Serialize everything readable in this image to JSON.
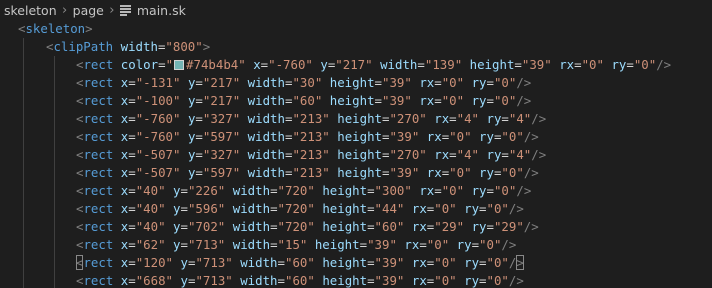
{
  "breadcrumb": {
    "items": [
      "skeleton",
      "page",
      "main.sk"
    ],
    "file_icon": "file-text-icon"
  },
  "editor": {
    "lines": [
      [
        [
          "p",
          "<"
        ],
        [
          "t",
          "skeleton"
        ],
        [
          "p",
          ">"
        ]
      ],
      [
        [
          "p",
          "<"
        ],
        [
          "t",
          "clipPath"
        ],
        [
          "x",
          " "
        ],
        [
          "a",
          "width"
        ],
        [
          "x",
          "="
        ],
        [
          "s",
          "\"800\""
        ],
        [
          "p",
          ">"
        ]
      ],
      [
        [
          "p",
          "<"
        ],
        [
          "t",
          "rect"
        ],
        [
          "x",
          " "
        ],
        [
          "a",
          "color"
        ],
        [
          "x",
          "="
        ],
        [
          "s",
          "\""
        ],
        [
          "sw",
          "#74b4b4"
        ],
        [
          "s",
          "#74b4b4\""
        ],
        [
          "x",
          " "
        ],
        [
          "a",
          "x"
        ],
        [
          "x",
          "="
        ],
        [
          "s",
          "\"-760\""
        ],
        [
          "x",
          " "
        ],
        [
          "a",
          "y"
        ],
        [
          "x",
          "="
        ],
        [
          "s",
          "\"217\""
        ],
        [
          "x",
          " "
        ],
        [
          "a",
          "width"
        ],
        [
          "x",
          "="
        ],
        [
          "s",
          "\"139\""
        ],
        [
          "x",
          " "
        ],
        [
          "a",
          "height"
        ],
        [
          "x",
          "="
        ],
        [
          "s",
          "\"39\""
        ],
        [
          "x",
          " "
        ],
        [
          "a",
          "rx"
        ],
        [
          "x",
          "="
        ],
        [
          "s",
          "\"0\""
        ],
        [
          "x",
          " "
        ],
        [
          "a",
          "ry"
        ],
        [
          "x",
          "="
        ],
        [
          "s",
          "\"0\""
        ],
        [
          "p",
          "/>"
        ]
      ],
      [
        [
          "p",
          "<"
        ],
        [
          "t",
          "rect"
        ],
        [
          "x",
          " "
        ],
        [
          "a",
          "x"
        ],
        [
          "x",
          "="
        ],
        [
          "s",
          "\"-131\""
        ],
        [
          "x",
          " "
        ],
        [
          "a",
          "y"
        ],
        [
          "x",
          "="
        ],
        [
          "s",
          "\"217\""
        ],
        [
          "x",
          " "
        ],
        [
          "a",
          "width"
        ],
        [
          "x",
          "="
        ],
        [
          "s",
          "\"30\""
        ],
        [
          "x",
          " "
        ],
        [
          "a",
          "height"
        ],
        [
          "x",
          "="
        ],
        [
          "s",
          "\"39\""
        ],
        [
          "x",
          " "
        ],
        [
          "a",
          "rx"
        ],
        [
          "x",
          "="
        ],
        [
          "s",
          "\"0\""
        ],
        [
          "x",
          " "
        ],
        [
          "a",
          "ry"
        ],
        [
          "x",
          "="
        ],
        [
          "s",
          "\"0\""
        ],
        [
          "p",
          "/>"
        ]
      ],
      [
        [
          "p",
          "<"
        ],
        [
          "t",
          "rect"
        ],
        [
          "x",
          " "
        ],
        [
          "a",
          "x"
        ],
        [
          "x",
          "="
        ],
        [
          "s",
          "\"-100\""
        ],
        [
          "x",
          " "
        ],
        [
          "a",
          "y"
        ],
        [
          "x",
          "="
        ],
        [
          "s",
          "\"217\""
        ],
        [
          "x",
          " "
        ],
        [
          "a",
          "width"
        ],
        [
          "x",
          "="
        ],
        [
          "s",
          "\"60\""
        ],
        [
          "x",
          " "
        ],
        [
          "a",
          "height"
        ],
        [
          "x",
          "="
        ],
        [
          "s",
          "\"39\""
        ],
        [
          "x",
          " "
        ],
        [
          "a",
          "rx"
        ],
        [
          "x",
          "="
        ],
        [
          "s",
          "\"0\""
        ],
        [
          "x",
          " "
        ],
        [
          "a",
          "ry"
        ],
        [
          "x",
          "="
        ],
        [
          "s",
          "\"0\""
        ],
        [
          "p",
          "/>"
        ]
      ],
      [
        [
          "p",
          "<"
        ],
        [
          "t",
          "rect"
        ],
        [
          "x",
          " "
        ],
        [
          "a",
          "x"
        ],
        [
          "x",
          "="
        ],
        [
          "s",
          "\"-760\""
        ],
        [
          "x",
          " "
        ],
        [
          "a",
          "y"
        ],
        [
          "x",
          "="
        ],
        [
          "s",
          "\"327\""
        ],
        [
          "x",
          " "
        ],
        [
          "a",
          "width"
        ],
        [
          "x",
          "="
        ],
        [
          "s",
          "\"213\""
        ],
        [
          "x",
          " "
        ],
        [
          "a",
          "height"
        ],
        [
          "x",
          "="
        ],
        [
          "s",
          "\"270\""
        ],
        [
          "x",
          " "
        ],
        [
          "a",
          "rx"
        ],
        [
          "x",
          "="
        ],
        [
          "s",
          "\"4\""
        ],
        [
          "x",
          " "
        ],
        [
          "a",
          "ry"
        ],
        [
          "x",
          "="
        ],
        [
          "s",
          "\"4\""
        ],
        [
          "p",
          "/>"
        ]
      ],
      [
        [
          "p",
          "<"
        ],
        [
          "t",
          "rect"
        ],
        [
          "x",
          " "
        ],
        [
          "a",
          "x"
        ],
        [
          "x",
          "="
        ],
        [
          "s",
          "\"-760\""
        ],
        [
          "x",
          " "
        ],
        [
          "a",
          "y"
        ],
        [
          "x",
          "="
        ],
        [
          "s",
          "\"597\""
        ],
        [
          "x",
          " "
        ],
        [
          "a",
          "width"
        ],
        [
          "x",
          "="
        ],
        [
          "s",
          "\"213\""
        ],
        [
          "x",
          " "
        ],
        [
          "a",
          "height"
        ],
        [
          "x",
          "="
        ],
        [
          "s",
          "\"39\""
        ],
        [
          "x",
          " "
        ],
        [
          "a",
          "rx"
        ],
        [
          "x",
          "="
        ],
        [
          "s",
          "\"0\""
        ],
        [
          "x",
          " "
        ],
        [
          "a",
          "ry"
        ],
        [
          "x",
          "="
        ],
        [
          "s",
          "\"0\""
        ],
        [
          "p",
          "/>"
        ]
      ],
      [
        [
          "p",
          "<"
        ],
        [
          "t",
          "rect"
        ],
        [
          "x",
          " "
        ],
        [
          "a",
          "x"
        ],
        [
          "x",
          "="
        ],
        [
          "s",
          "\"-507\""
        ],
        [
          "x",
          " "
        ],
        [
          "a",
          "y"
        ],
        [
          "x",
          "="
        ],
        [
          "s",
          "\"327\""
        ],
        [
          "x",
          " "
        ],
        [
          "a",
          "width"
        ],
        [
          "x",
          "="
        ],
        [
          "s",
          "\"213\""
        ],
        [
          "x",
          " "
        ],
        [
          "a",
          "height"
        ],
        [
          "x",
          "="
        ],
        [
          "s",
          "\"270\""
        ],
        [
          "x",
          " "
        ],
        [
          "a",
          "rx"
        ],
        [
          "x",
          "="
        ],
        [
          "s",
          "\"4\""
        ],
        [
          "x",
          " "
        ],
        [
          "a",
          "ry"
        ],
        [
          "x",
          "="
        ],
        [
          "s",
          "\"4\""
        ],
        [
          "p",
          "/>"
        ]
      ],
      [
        [
          "p",
          "<"
        ],
        [
          "t",
          "rect"
        ],
        [
          "x",
          " "
        ],
        [
          "a",
          "x"
        ],
        [
          "x",
          "="
        ],
        [
          "s",
          "\"-507\""
        ],
        [
          "x",
          " "
        ],
        [
          "a",
          "y"
        ],
        [
          "x",
          "="
        ],
        [
          "s",
          "\"597\""
        ],
        [
          "x",
          " "
        ],
        [
          "a",
          "width"
        ],
        [
          "x",
          "="
        ],
        [
          "s",
          "\"213\""
        ],
        [
          "x",
          " "
        ],
        [
          "a",
          "height"
        ],
        [
          "x",
          "="
        ],
        [
          "s",
          "\"39\""
        ],
        [
          "x",
          " "
        ],
        [
          "a",
          "rx"
        ],
        [
          "x",
          "="
        ],
        [
          "s",
          "\"0\""
        ],
        [
          "x",
          " "
        ],
        [
          "a",
          "ry"
        ],
        [
          "x",
          "="
        ],
        [
          "s",
          "\"0\""
        ],
        [
          "p",
          "/>"
        ]
      ],
      [
        [
          "p",
          "<"
        ],
        [
          "t",
          "rect"
        ],
        [
          "x",
          " "
        ],
        [
          "a",
          "x"
        ],
        [
          "x",
          "="
        ],
        [
          "s",
          "\"40\""
        ],
        [
          "x",
          " "
        ],
        [
          "a",
          "y"
        ],
        [
          "x",
          "="
        ],
        [
          "s",
          "\"226\""
        ],
        [
          "x",
          " "
        ],
        [
          "a",
          "width"
        ],
        [
          "x",
          "="
        ],
        [
          "s",
          "\"720\""
        ],
        [
          "x",
          " "
        ],
        [
          "a",
          "height"
        ],
        [
          "x",
          "="
        ],
        [
          "s",
          "\"300\""
        ],
        [
          "x",
          " "
        ],
        [
          "a",
          "rx"
        ],
        [
          "x",
          "="
        ],
        [
          "s",
          "\"0\""
        ],
        [
          "x",
          " "
        ],
        [
          "a",
          "ry"
        ],
        [
          "x",
          "="
        ],
        [
          "s",
          "\"0\""
        ],
        [
          "p",
          "/>"
        ]
      ],
      [
        [
          "p",
          "<"
        ],
        [
          "t",
          "rect"
        ],
        [
          "x",
          " "
        ],
        [
          "a",
          "x"
        ],
        [
          "x",
          "="
        ],
        [
          "s",
          "\"40\""
        ],
        [
          "x",
          " "
        ],
        [
          "a",
          "y"
        ],
        [
          "x",
          "="
        ],
        [
          "s",
          "\"596\""
        ],
        [
          "x",
          " "
        ],
        [
          "a",
          "width"
        ],
        [
          "x",
          "="
        ],
        [
          "s",
          "\"720\""
        ],
        [
          "x",
          " "
        ],
        [
          "a",
          "height"
        ],
        [
          "x",
          "="
        ],
        [
          "s",
          "\"44\""
        ],
        [
          "x",
          " "
        ],
        [
          "a",
          "rx"
        ],
        [
          "x",
          "="
        ],
        [
          "s",
          "\"0\""
        ],
        [
          "x",
          " "
        ],
        [
          "a",
          "ry"
        ],
        [
          "x",
          "="
        ],
        [
          "s",
          "\"0\""
        ],
        [
          "p",
          "/>"
        ]
      ],
      [
        [
          "p",
          "<"
        ],
        [
          "t",
          "rect"
        ],
        [
          "x",
          " "
        ],
        [
          "a",
          "x"
        ],
        [
          "x",
          "="
        ],
        [
          "s",
          "\"40\""
        ],
        [
          "x",
          " "
        ],
        [
          "a",
          "y"
        ],
        [
          "x",
          "="
        ],
        [
          "s",
          "\"702\""
        ],
        [
          "x",
          " "
        ],
        [
          "a",
          "width"
        ],
        [
          "x",
          "="
        ],
        [
          "s",
          "\"720\""
        ],
        [
          "x",
          " "
        ],
        [
          "a",
          "height"
        ],
        [
          "x",
          "="
        ],
        [
          "s",
          "\"60\""
        ],
        [
          "x",
          " "
        ],
        [
          "a",
          "rx"
        ],
        [
          "x",
          "="
        ],
        [
          "s",
          "\"29\""
        ],
        [
          "x",
          " "
        ],
        [
          "a",
          "ry"
        ],
        [
          "x",
          "="
        ],
        [
          "s",
          "\"29\""
        ],
        [
          "p",
          "/>"
        ]
      ],
      [
        [
          "p",
          "<"
        ],
        [
          "t",
          "rect"
        ],
        [
          "x",
          " "
        ],
        [
          "a",
          "x"
        ],
        [
          "x",
          "="
        ],
        [
          "s",
          "\"62\""
        ],
        [
          "x",
          " "
        ],
        [
          "a",
          "y"
        ],
        [
          "x",
          "="
        ],
        [
          "s",
          "\"713\""
        ],
        [
          "x",
          " "
        ],
        [
          "a",
          "width"
        ],
        [
          "x",
          "="
        ],
        [
          "s",
          "\"15\""
        ],
        [
          "x",
          " "
        ],
        [
          "a",
          "height"
        ],
        [
          "x",
          "="
        ],
        [
          "s",
          "\"39\""
        ],
        [
          "x",
          " "
        ],
        [
          "a",
          "rx"
        ],
        [
          "x",
          "="
        ],
        [
          "s",
          "\"0\""
        ],
        [
          "x",
          " "
        ],
        [
          "a",
          "ry"
        ],
        [
          "x",
          "="
        ],
        [
          "s",
          "\"0\""
        ],
        [
          "p",
          "/>"
        ]
      ],
      [
        [
          "pb",
          "<"
        ],
        [
          "t",
          "rect"
        ],
        [
          "x",
          " "
        ],
        [
          "a",
          "x"
        ],
        [
          "x",
          "="
        ],
        [
          "s",
          "\"120\""
        ],
        [
          "x",
          " "
        ],
        [
          "a",
          "y"
        ],
        [
          "x",
          "="
        ],
        [
          "s",
          "\"713\""
        ],
        [
          "x",
          " "
        ],
        [
          "a",
          "width"
        ],
        [
          "x",
          "="
        ],
        [
          "s",
          "\"60\""
        ],
        [
          "x",
          " "
        ],
        [
          "a",
          "height"
        ],
        [
          "x",
          "="
        ],
        [
          "s",
          "\"39\""
        ],
        [
          "x",
          " "
        ],
        [
          "a",
          "rx"
        ],
        [
          "x",
          "="
        ],
        [
          "s",
          "\"0\""
        ],
        [
          "x",
          " "
        ],
        [
          "a",
          "ry"
        ],
        [
          "x",
          "="
        ],
        [
          "s",
          "\"0\""
        ],
        [
          "p",
          "/"
        ],
        [
          "pb",
          ">"
        ]
      ],
      [
        [
          "p",
          "<"
        ],
        [
          "t",
          "rect"
        ],
        [
          "x",
          " "
        ],
        [
          "a",
          "x"
        ],
        [
          "x",
          "="
        ],
        [
          "s",
          "\"668\""
        ],
        [
          "x",
          " "
        ],
        [
          "a",
          "y"
        ],
        [
          "x",
          "="
        ],
        [
          "s",
          "\"713\""
        ],
        [
          "x",
          " "
        ],
        [
          "a",
          "width"
        ],
        [
          "x",
          "="
        ],
        [
          "s",
          "\"60\""
        ],
        [
          "x",
          " "
        ],
        [
          "a",
          "height"
        ],
        [
          "x",
          "="
        ],
        [
          "s",
          "\"39\""
        ],
        [
          "x",
          " "
        ],
        [
          "a",
          "rx"
        ],
        [
          "x",
          "="
        ],
        [
          "s",
          "\"0\""
        ],
        [
          "x",
          " "
        ],
        [
          "a",
          "ry"
        ],
        [
          "x",
          "="
        ],
        [
          "s",
          "\"0\""
        ],
        [
          "p",
          "/>"
        ]
      ]
    ]
  }
}
